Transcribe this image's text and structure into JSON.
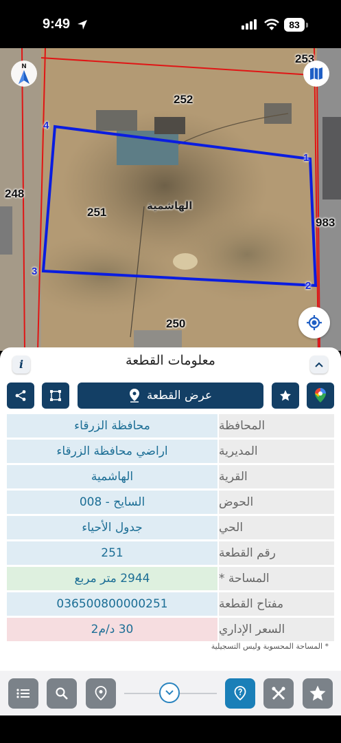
{
  "status_bar": {
    "time": "9:49",
    "battery": "83"
  },
  "map": {
    "compass_label": "N",
    "parcel_labels": {
      "north": "252",
      "west": "248",
      "center": "251",
      "south": "250",
      "east": "983",
      "corner": "253"
    },
    "vertices": {
      "v1": "1",
      "v2": "2",
      "v3": "3",
      "v4": "4"
    },
    "village_label": "الهاشمية",
    "boundary_color": "#0a1de0",
    "plot_line_color": "#e01515"
  },
  "panel": {
    "title": "معلومات القطعة",
    "info_icon_text": "i",
    "show_parcel_label": "عرض القطعة",
    "rows": [
      {
        "label": "المحافظة",
        "value": "محافظة الزرقاء"
      },
      {
        "label": "المديرية",
        "value": "اراضي محافظة الزرقاء"
      },
      {
        "label": "القرية",
        "value": "الهاشمية"
      },
      {
        "label": "الحوض",
        "value": "السايح - 008"
      },
      {
        "label": "الحي",
        "value": "جدول الأحياء"
      },
      {
        "label": "رقم القطعة",
        "value": "251"
      },
      {
        "label": "المساحة *",
        "value": "2944  متر مربع"
      },
      {
        "label": "مفتاح القطعة",
        "value": "036500800000251"
      },
      {
        "label": "السعر الإداري",
        "value": "30 د/م2"
      }
    ],
    "footnote": "* المساحة المحسوبة وليس التسجيلية"
  },
  "colors": {
    "primary_dark": "#133f65",
    "accent_blue": "#1a7fb8",
    "value_text": "#1c6e95"
  }
}
